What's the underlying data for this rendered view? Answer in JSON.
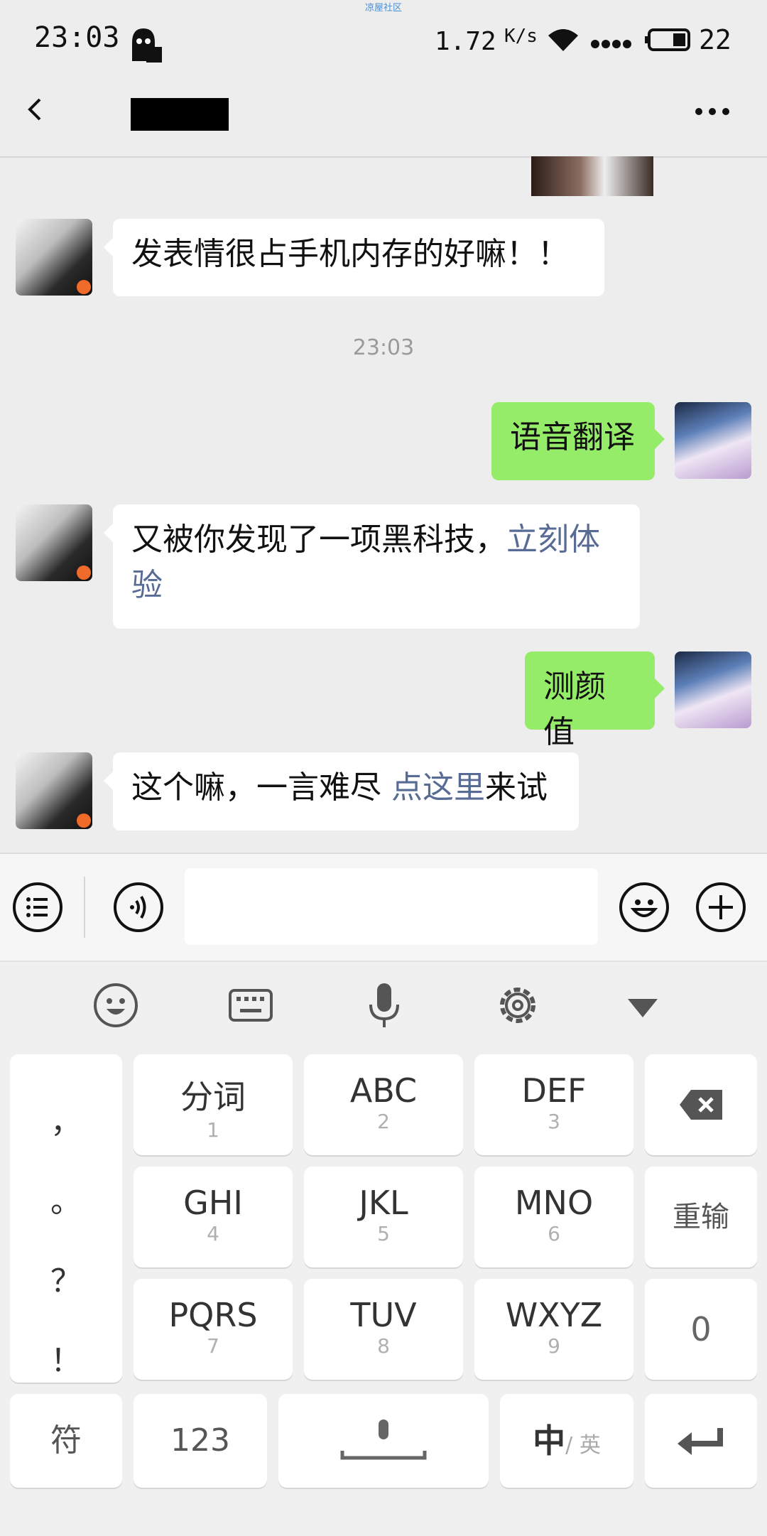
{
  "status_bar": {
    "time": "23:03",
    "net_speed": "1.72",
    "net_unit": "K/s",
    "battery": "22",
    "watermark": "凉屋社区"
  },
  "header": {
    "back_icon": "chevron-left-icon",
    "more_icon": "more-dots-icon"
  },
  "messages": [
    {
      "side": "left",
      "text": "发表情很占手机内存的好嘛！！"
    },
    {
      "side": "time",
      "text": "23:03"
    },
    {
      "side": "right",
      "text": "语音翻译"
    },
    {
      "side": "left",
      "text": "又被你发现了一项黑科技，",
      "link": "立刻体验"
    },
    {
      "side": "right",
      "text": "测颜值"
    },
    {
      "side": "left",
      "text": "这个嘛，一言难尽 ",
      "link": "点这里",
      "after": "来试"
    }
  ],
  "input_bar": {
    "menu_icon": "list-menu-icon",
    "voice_icon": "voice-icon",
    "emoji_icon": "emoji-icon",
    "plus_icon": "plus-icon",
    "input_value": ""
  },
  "keyboard": {
    "toolbar": [
      "emoji-icon",
      "keyboard-icon",
      "microphone-icon",
      "settings-gear-icon",
      "collapse-triangle-icon"
    ],
    "punct": [
      "，",
      "。",
      "？",
      "！"
    ],
    "rows": [
      [
        {
          "main": "分词",
          "sub": "1"
        },
        {
          "main": "ABC",
          "sub": "2"
        },
        {
          "main": "DEF",
          "sub": "3"
        }
      ],
      [
        {
          "main": "GHI",
          "sub": "4"
        },
        {
          "main": "JKL",
          "sub": "5"
        },
        {
          "main": "MNO",
          "sub": "6"
        }
      ],
      [
        {
          "main": "PQRS",
          "sub": "7"
        },
        {
          "main": "TUV",
          "sub": "8"
        },
        {
          "main": "WXYZ",
          "sub": "9"
        }
      ]
    ],
    "side_keys": {
      "retype": "重输",
      "zero": "0"
    },
    "bottom": {
      "symbols": "符",
      "numbers": "123",
      "lang_main": "中",
      "lang_sub": "/ 英"
    }
  }
}
